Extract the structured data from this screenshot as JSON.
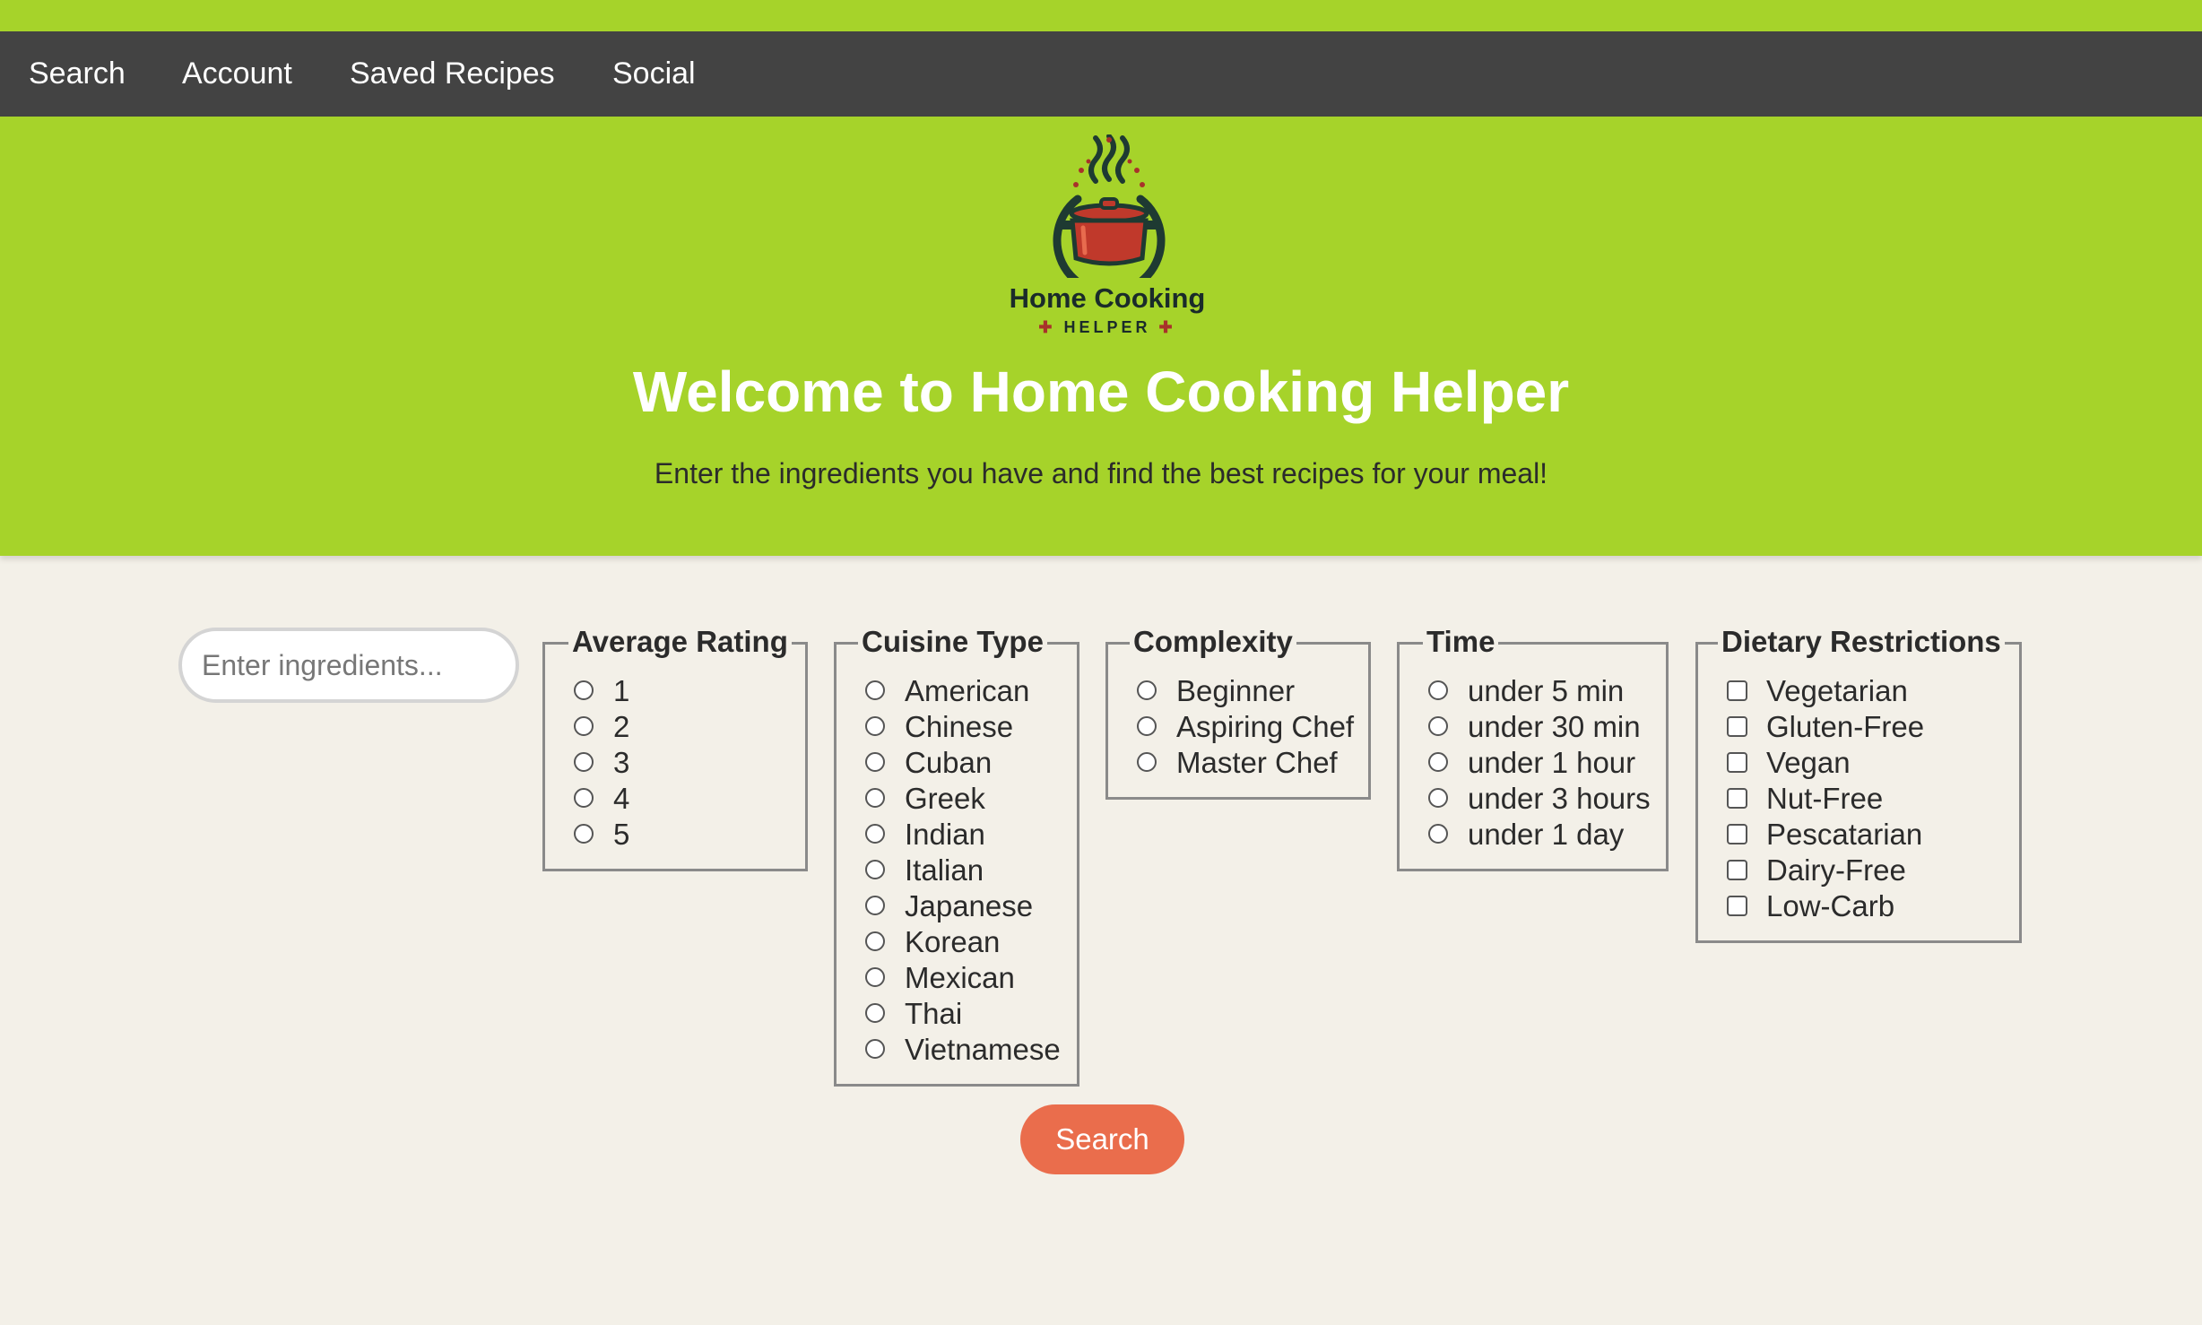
{
  "nav": {
    "items": [
      {
        "label": "Search"
      },
      {
        "label": "Account"
      },
      {
        "label": "Saved Recipes"
      },
      {
        "label": "Social"
      }
    ]
  },
  "brand": {
    "name_line1": "Home Cooking",
    "name_line2": "HELPER"
  },
  "hero": {
    "title": "Welcome to Home Cooking Helper",
    "subtitle": "Enter the ingredients you have and find the best recipes for your meal!"
  },
  "search": {
    "placeholder": "Enter ingredients...",
    "value": "",
    "button_label": "Search"
  },
  "filters": {
    "rating": {
      "legend": "Average Rating",
      "options": [
        "1",
        "2",
        "3",
        "4",
        "5"
      ]
    },
    "cuisine": {
      "legend": "Cuisine Type",
      "options": [
        "American",
        "Chinese",
        "Cuban",
        "Greek",
        "Indian",
        "Italian",
        "Japanese",
        "Korean",
        "Mexican",
        "Thai",
        "Vietnamese"
      ]
    },
    "complexity": {
      "legend": "Complexity",
      "options": [
        "Beginner",
        "Aspiring Chef",
        "Master Chef"
      ]
    },
    "time": {
      "legend": "Time",
      "options": [
        "under 5 min",
        "under 30 min",
        "under 1 hour",
        "under 3 hours",
        "under 1 day"
      ]
    },
    "dietary": {
      "legend": "Dietary Restrictions",
      "options": [
        "Vegetarian",
        "Gluten-Free",
        "Vegan",
        "Nut-Free",
        "Pescatarian",
        "Dairy-Free",
        "Low-Carb"
      ]
    }
  },
  "colors": {
    "accent_green": "#a6d32a",
    "nav_background": "#434343",
    "page_background": "#f3f0e8",
    "button": "#ea6d4c"
  }
}
